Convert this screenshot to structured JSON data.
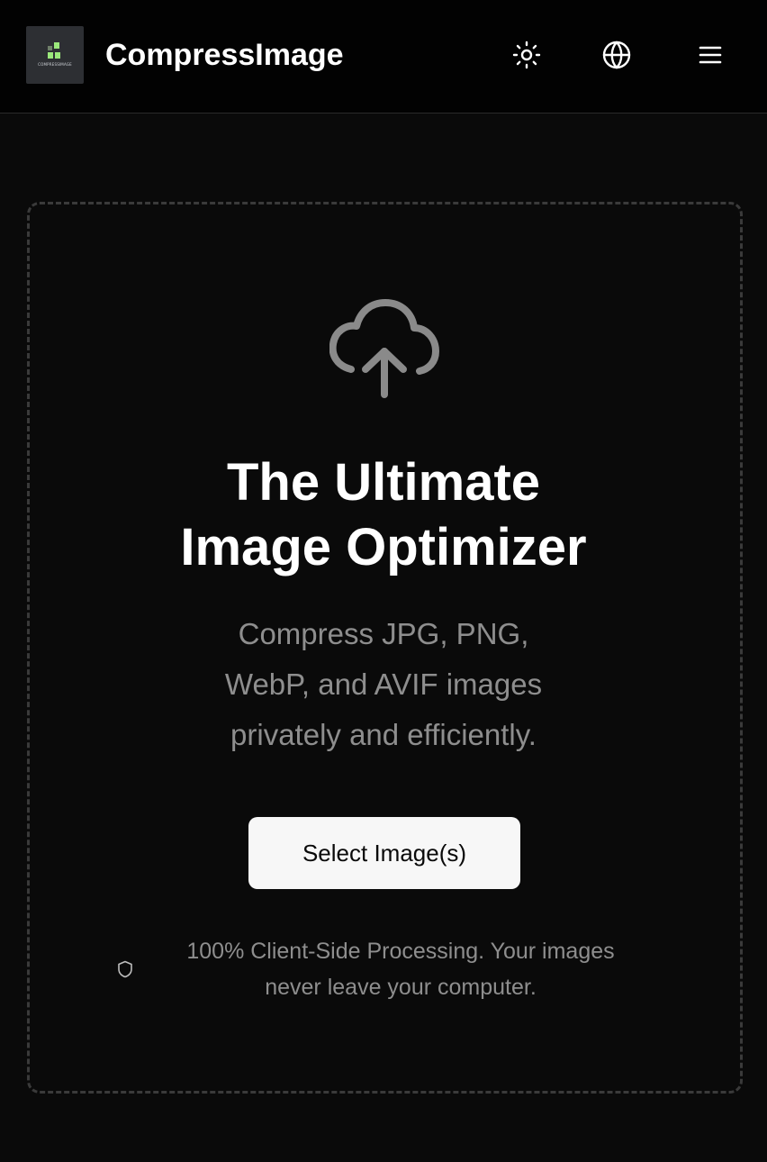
{
  "header": {
    "logo_text": "COMPRESSIMAGE",
    "title": "CompressImage",
    "icons": [
      "sun-icon",
      "globe-icon",
      "menu-icon"
    ]
  },
  "hero": {
    "headline_line1": "The Ultimate",
    "headline_line2": "Image Optimizer",
    "subtitle_line1": "Compress JPG, PNG,",
    "subtitle_line2": "WebP, and AVIF images",
    "subtitle_line3": "privately and efficiently.",
    "select_button": "Select Image(s)",
    "privacy_line1": "100% Client-Side Processing. Your images",
    "privacy_line2": "never leave your computer."
  },
  "colors": {
    "background": "#0a0a0a",
    "header_bg": "#020202",
    "text_primary": "#ffffff",
    "text_muted": "#8e8e8e",
    "button_bg": "#f7f7f7",
    "logo_accent": "#9be87b"
  }
}
